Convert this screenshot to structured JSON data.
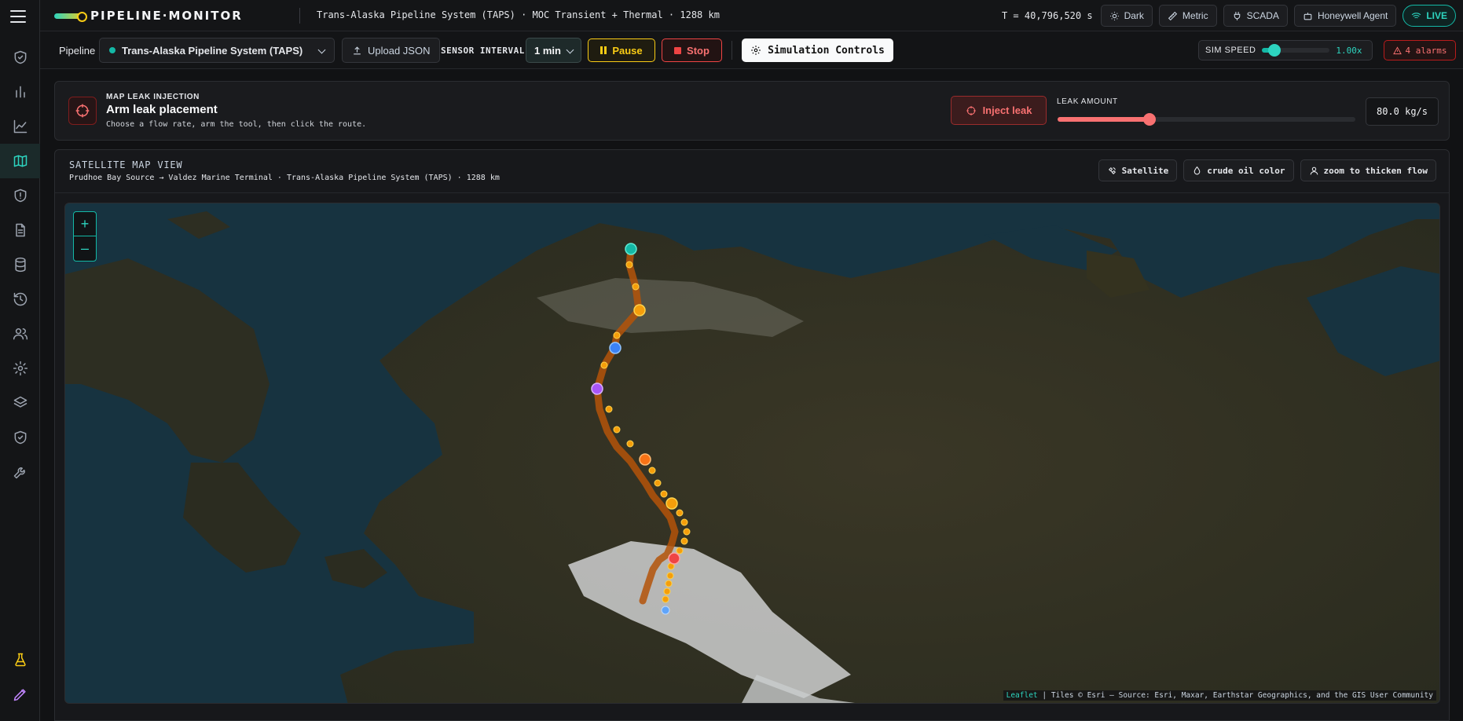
{
  "app": {
    "title": "PIPELINE·MONITOR",
    "context": "Trans-Alaska Pipeline System (TAPS) · MOC Transient + Thermal · 1288 km",
    "timer": "T = 40,796,520 s"
  },
  "top_buttons": {
    "theme": "Dark",
    "units": "Metric",
    "scada": "SCADA",
    "agent": "Honeywell Agent",
    "live": "LIVE"
  },
  "toolbar": {
    "pipeline_label": "Pipeline",
    "pipeline_value": "Trans-Alaska Pipeline System (TAPS)",
    "upload_label": "Upload JSON",
    "sensor_interval_label": "SENSOR INTERVAL",
    "sensor_interval_value": "1 min",
    "pause_label": "Pause",
    "stop_label": "Stop",
    "sim_controls_label": "Simulation Controls",
    "sim_speed_label": "SIM SPEED",
    "sim_speed_value": "1.00x",
    "sim_speed_fraction": 0.18,
    "alarms_label": "4 alarms"
  },
  "leak": {
    "kicker": "MAP LEAK INJECTION",
    "title": "Arm leak placement",
    "subtitle": "Choose a flow rate, arm the tool, then click the route.",
    "inject_label": "Inject leak",
    "amount_label": "LEAK AMOUNT",
    "amount_value": "80.0 kg/s",
    "amount_fraction": 0.31
  },
  "map_panel": {
    "title": "SATELLITE MAP VIEW",
    "subtitle": "Prudhoe Bay Source → Valdez Marine Terminal · Trans-Alaska Pipeline System (TAPS) · 1288 km",
    "btn_satellite": "Satellite",
    "btn_color": "crude oil color",
    "btn_zoom": "zoom to thicken flow",
    "zoom_in": "+",
    "zoom_out": "–",
    "attribution_leaflet": "Leaflet",
    "attribution_rest": "| Tiles © Esri — Source: Esri, Maxar, Earthstar Geographics, and the GIS User Community"
  },
  "colors": {
    "accent": "#2dd4bf",
    "warning": "#facc15",
    "danger": "#ef4444",
    "pipeline": "#d97706"
  },
  "icons": {
    "sidebar": [
      "menu-icon",
      "shield-check-icon",
      "bar-chart-icon",
      "line-chart-icon",
      "map-icon",
      "shield-alert-icon",
      "file-text-icon",
      "database-icon",
      "history-icon",
      "users-icon",
      "gear-icon",
      "layers-icon",
      "shield-check-icon",
      "wrench-icon",
      "flask-icon",
      "ruler-pen-icon"
    ]
  }
}
